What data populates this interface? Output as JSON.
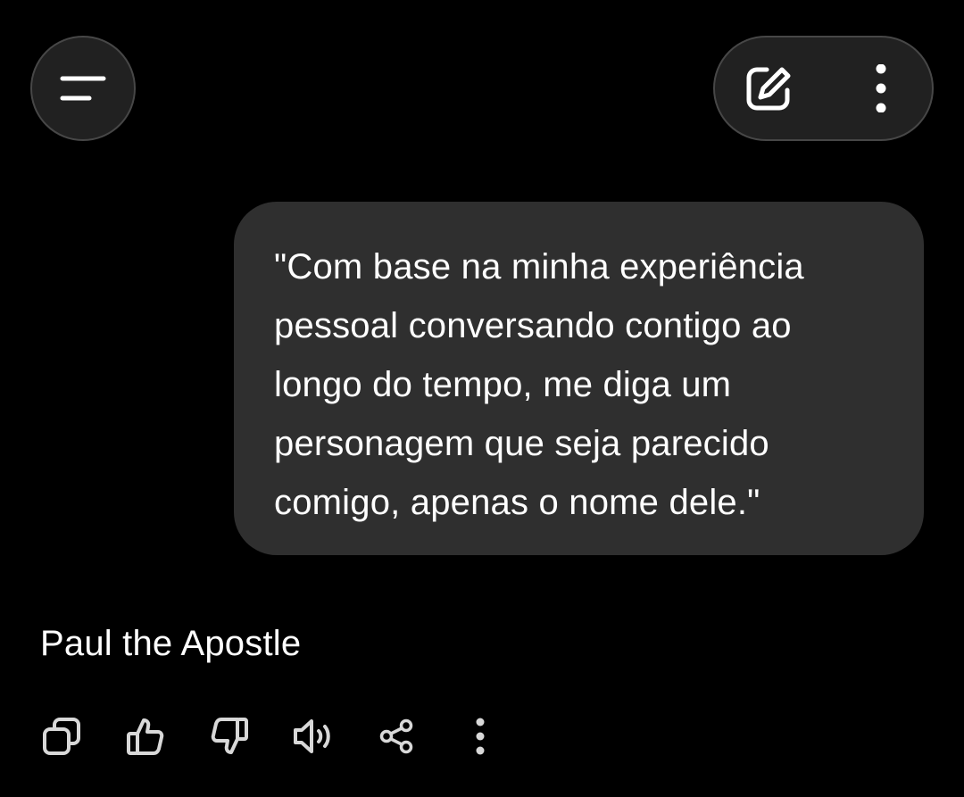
{
  "header": {
    "menu_icon": "menu-lines-icon",
    "edit_icon": "edit-pencil-icon",
    "more_icon": "more-vertical-icon"
  },
  "conversation": {
    "user_message": "\"Com base na minha experiência\npessoal conversando contigo ao\nlongo do tempo, me diga um\npersonagem que seja parecido\ncomigo, apenas o nome dele.\"",
    "assistant_message": "Paul the Apostle"
  },
  "actions": {
    "icons": [
      "copy-icon",
      "thumbs-up-icon",
      "thumbs-down-icon",
      "read-aloud-icon",
      "share-icon",
      "more-vertical-icon"
    ]
  },
  "colors": {
    "background": "#000000",
    "bubble": "#2f2f2f",
    "button_fill": "#212121",
    "button_border": "#474747",
    "icon": "#d8d8d8"
  }
}
